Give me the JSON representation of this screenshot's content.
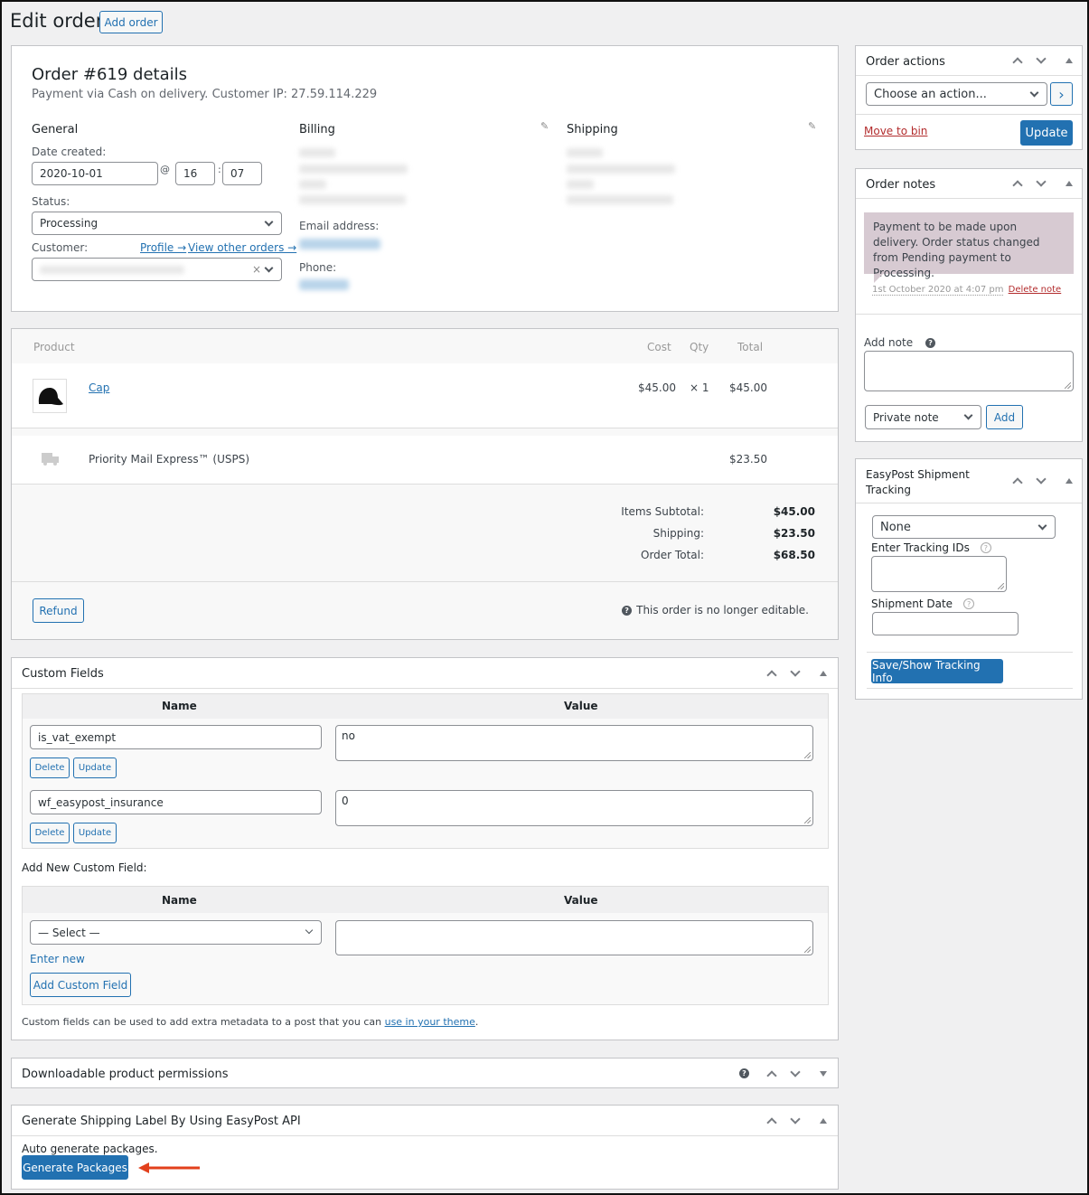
{
  "page": {
    "title": "Edit order",
    "add_order_label": "Add order"
  },
  "order": {
    "heading": "Order #619 details",
    "subheading": "Payment via Cash on delivery. Customer IP: 27.59.114.229",
    "general": {
      "label": "General",
      "date_created_label": "Date created:",
      "date": "2020-10-01",
      "at_symbol": "@",
      "hour": "16",
      "colon": ":",
      "minute": "07",
      "status_label": "Status:",
      "status": "Processing",
      "customer_label": "Customer:",
      "profile_link": "Profile →",
      "other_orders_link": "View other orders →",
      "customer_clear": "×"
    },
    "billing": {
      "label": "Billing",
      "email_label": "Email address:",
      "phone_label": "Phone:"
    },
    "shipping": {
      "label": "Shipping"
    }
  },
  "items": {
    "headers": {
      "product": "Product",
      "cost": "Cost",
      "qty": "Qty",
      "total": "Total"
    },
    "rows": [
      {
        "name": "Cap",
        "cost": "$45.00",
        "qty": "× 1",
        "total": "$45.00"
      }
    ],
    "shipping_line": {
      "name": "Priority Mail Express™ (USPS)",
      "total": "$23.50"
    },
    "totals": [
      {
        "label": "Items Subtotal:",
        "value": "$45.00"
      },
      {
        "label": "Shipping:",
        "value": "$23.50"
      },
      {
        "label": "Order Total:",
        "value": "$68.50"
      }
    ],
    "refund_label": "Refund",
    "not_editable": "This order is no longer editable."
  },
  "custom_fields": {
    "title": "Custom Fields",
    "name_header": "Name",
    "value_header": "Value",
    "rows": [
      {
        "name": "is_vat_exempt",
        "value": "no"
      },
      {
        "name": "wf_easypost_insurance",
        "value": "0"
      }
    ],
    "delete_label": "Delete",
    "update_label": "Update",
    "add_new_label": "Add New Custom Field:",
    "select_placeholder": "— Select —",
    "enter_new": "Enter new",
    "add_button": "Add Custom Field",
    "footer_text": "Custom fields can be used to add extra metadata to a post that you can ",
    "footer_link": "use in your theme",
    "footer_end": "."
  },
  "downloads": {
    "title": "Downloadable product permissions"
  },
  "easypost_label": {
    "title": "Generate Shipping Label By Using EasyPost API",
    "auto_text": "Auto generate packages.",
    "button": "Generate Packages"
  },
  "order_actions": {
    "title": "Order actions",
    "select": "Choose an action...",
    "go": "›",
    "move_to_bin": "Move to bin",
    "update": "Update"
  },
  "order_notes": {
    "title": "Order notes",
    "note_text": "Payment to be made upon delivery. Order status changed from Pending payment to Processing.",
    "note_date": "1st October 2020 at 4:07 pm",
    "delete_note": "Delete note",
    "add_note_label": "Add note",
    "note_type": "Private note",
    "add_button": "Add"
  },
  "tracking": {
    "title": "EasyPost Shipment Tracking",
    "carrier": "None",
    "tracking_ids_label": "Enter Tracking IDs",
    "shipment_date_label": "Shipment Date",
    "save_button": "Save/Show Tracking Info"
  },
  "colors": {
    "accent": "#2271b1",
    "danger": "#b32d2e",
    "note_bg": "#d7cad2",
    "arrow": "#e2401c"
  }
}
